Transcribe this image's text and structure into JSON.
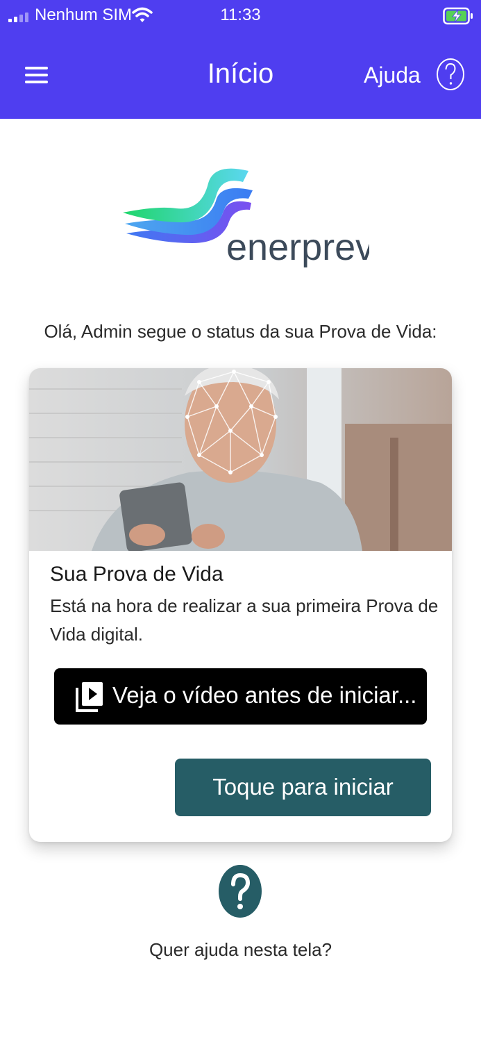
{
  "status_bar": {
    "carrier": "Nenhum SIM",
    "time": "11:33"
  },
  "nav": {
    "title": "Início",
    "help_label": "Ajuda"
  },
  "logo": {
    "text": "enerprev"
  },
  "greeting": "Olá, Admin segue o status da sua Prova de Vida:",
  "card": {
    "title": "Sua Prova de Vida",
    "text": "Está na hora de realizar a sua primeira Prova de Vida digital.",
    "video_button_label": "Veja o vídeo antes de iniciar...",
    "start_button_label": "Toque para iniciar"
  },
  "help_footer": {
    "text": "Quer ajuda nesta tela?"
  },
  "colors": {
    "header_bg": "#4f3ef0",
    "start_button_bg": "#265d66",
    "video_button_bg": "#000000"
  }
}
